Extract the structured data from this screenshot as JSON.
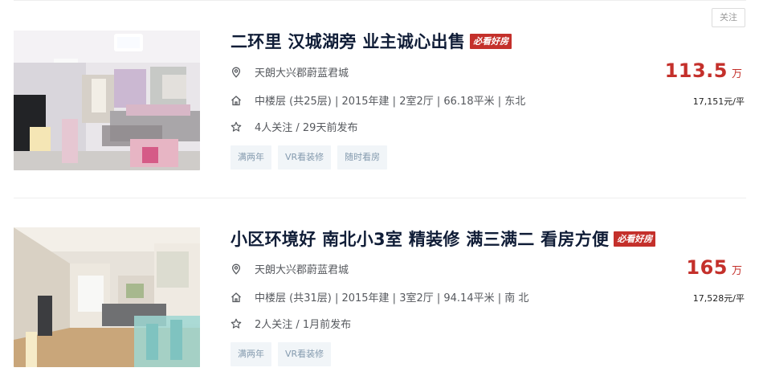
{
  "follow_button": "关注",
  "listings": [
    {
      "title": "二环里 汉城湖旁 业主诚心出售",
      "badge": "必看好房",
      "community": "天朗大兴郡蔚蓝君城",
      "house_info": "中楼层 (共25层) | 2015年建 | 2室2厅 | 66.18平米 | 东北",
      "follow_info": "4人关注 / 29天前发布",
      "tags": [
        "满两年",
        "VR看装修",
        "随时看房"
      ],
      "price": "113.5",
      "price_unit": "万",
      "unit_price": "17,151元/平"
    },
    {
      "title": "小区环境好 南北小3室 精装修 满三满二 看房方便",
      "badge": "必看好房",
      "community": "天朗大兴郡蔚蓝君城",
      "house_info": "中楼层 (共31层) | 2015年建 | 3室2厅 | 94.14平米 | 南 北",
      "follow_info": "2人关注 / 1月前发布",
      "tags": [
        "满两年",
        "VR看装修"
      ],
      "price": "165",
      "price_unit": "万",
      "unit_price": "17,528元/平"
    }
  ],
  "colors": {
    "accent": "#c4302b",
    "title": "#101d37",
    "tag_bg": "#f1f5f8",
    "tag_text": "#849aae"
  },
  "icons": [
    "location-icon",
    "house-icon",
    "star-icon"
  ]
}
